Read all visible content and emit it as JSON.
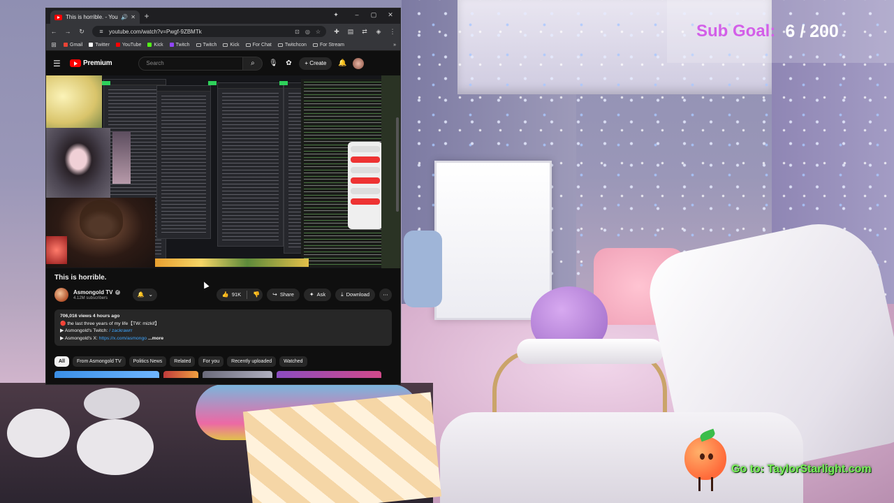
{
  "overlay": {
    "sub_goal_label": "Sub Goal:",
    "sub_goal_value": "6 / 200",
    "promo_text": "Go to: TaylorStarlight.com"
  },
  "browser": {
    "tab_title": "This is horrible. - YouTube",
    "tab_icons": [
      "speaker-icon",
      "close-icon"
    ],
    "new_tab": "+",
    "url": "youtube.com/watch?v=Pwgf-9ZBMTk",
    "bookmarks": [
      {
        "label": "Gmail",
        "color": "#ea4335",
        "kind": "site"
      },
      {
        "label": "Twitter",
        "color": "#ffffff",
        "kind": "site"
      },
      {
        "label": "YouTube",
        "color": "#ff0000",
        "kind": "site"
      },
      {
        "label": "Kick",
        "color": "#53fc18",
        "kind": "site"
      },
      {
        "label": "Twitch",
        "color": "#9146ff",
        "kind": "site"
      },
      {
        "label": "Twitch",
        "kind": "folder"
      },
      {
        "label": "Kick",
        "kind": "folder"
      },
      {
        "label": "For Chat",
        "kind": "folder"
      },
      {
        "label": "Twitchcon",
        "kind": "folder"
      },
      {
        "label": "For Stream",
        "kind": "folder"
      }
    ],
    "bookmarks_overflow": "»"
  },
  "youtube": {
    "logo_text": "Premium",
    "search_placeholder": "Search",
    "create_label": "+ Create",
    "video": {
      "title": "This is horrible.",
      "channel": "Asmongold TV",
      "subscribers": "4.12M subscribers",
      "likes": "91K",
      "share_label": "Share",
      "ask_label": "Ask",
      "download_label": "Download"
    },
    "description": {
      "stats": "706,016 views  4 hours ago",
      "line1": "🔴 the last three years of my life【TW: mizkif】",
      "line2_prefix": "▶ Asmongold's Twitch: ",
      "line2_link": "/ zackrawrr",
      "line3_prefix": "▶ Asmongold's X: ",
      "line3_link": "https://x.com/asmongo",
      "more": "...more"
    },
    "chips": [
      "All",
      "From Asmongold TV",
      "Politics News",
      "Related",
      "For you",
      "Recently uploaded",
      "Watched"
    ]
  },
  "colors": {
    "sub_goal_label": "#d35fe8",
    "promo_text": "#7bf05b",
    "youtube_red": "#ff0000",
    "link_blue": "#3ea6ff"
  }
}
